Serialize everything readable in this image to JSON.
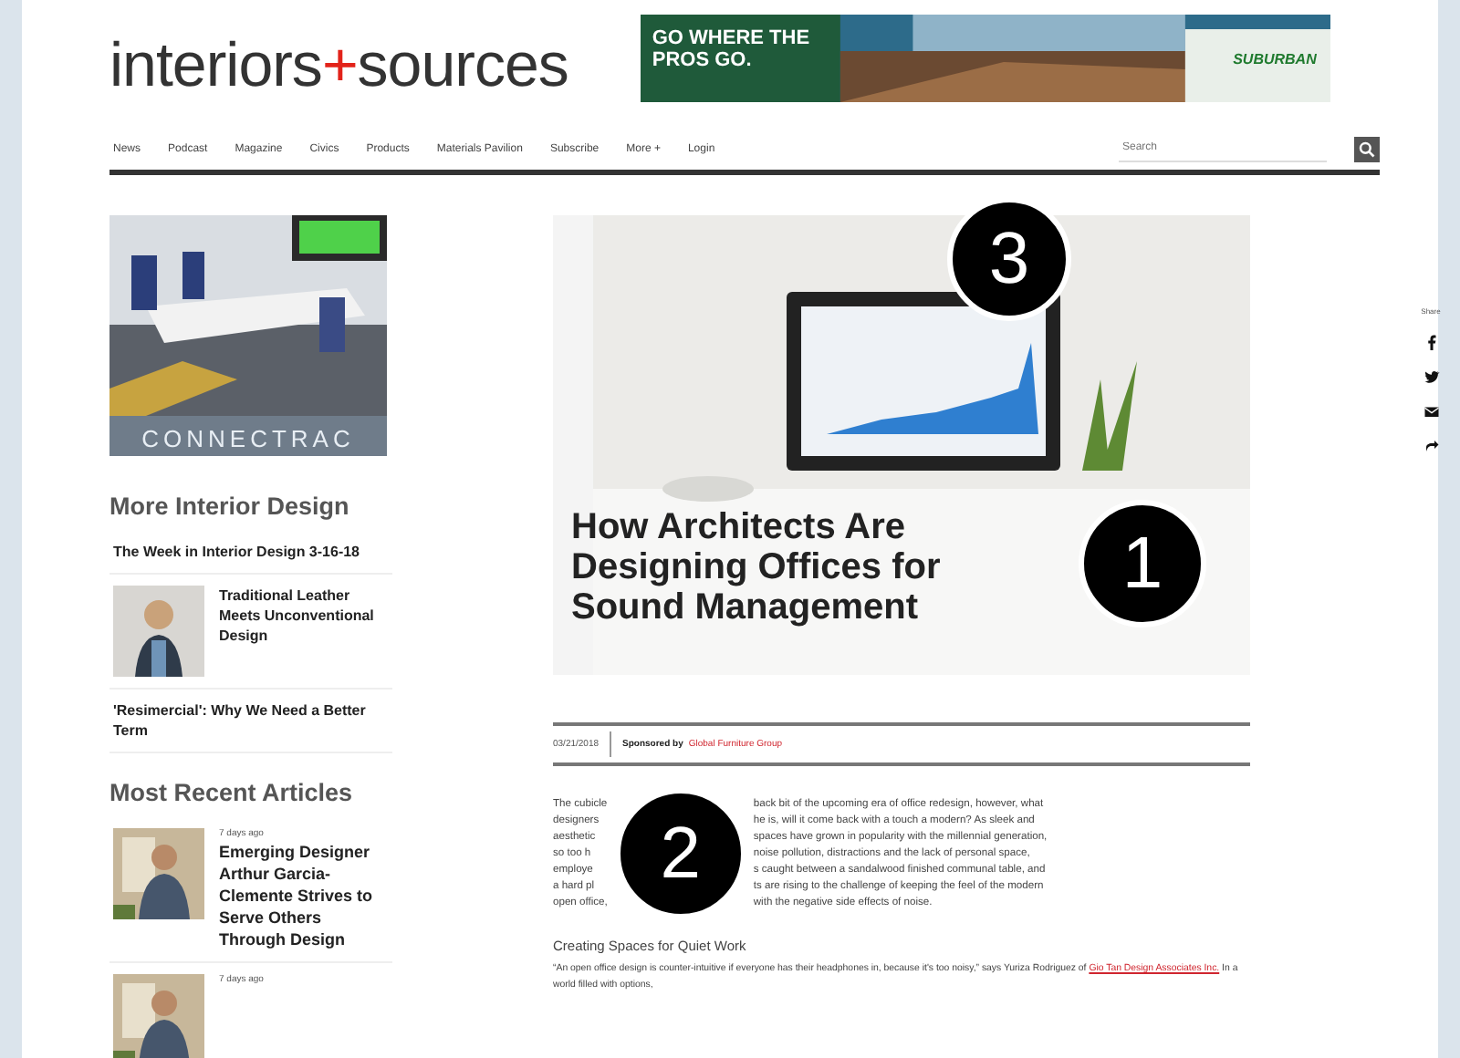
{
  "logo": {
    "text": "interiors",
    "plus": "+",
    "rest": "sources"
  },
  "ad_banner": {
    "headline": "GO WHERE THE PROS GO.",
    "brand": "SUBURBAN"
  },
  "nav": {
    "items": [
      "News",
      "Podcast",
      "Magazine",
      "Civics",
      "Products",
      "Materials Pavilion",
      "Subscribe",
      "More +",
      "Login"
    ],
    "search": {
      "placeholder": "Search"
    }
  },
  "sidebar": {
    "ad": {
      "caption": "CONNECTRAC"
    },
    "more_heading": "More Interior Design",
    "more_items": [
      {
        "title": "The Week in Interior Design 3-16-18",
        "thumbnail": false
      },
      {
        "title": "Traditional Leather Meets Unconventional Design",
        "thumbnail": true
      },
      {
        "title": "'Resimercial': Why We Need a Better Term",
        "thumbnail": false
      }
    ],
    "recent_heading": "Most Recent Articles",
    "recent_items": [
      {
        "time": "7 days ago",
        "title": "Emerging Designer Arthur Garcia-Clemente Strives to Serve Others Through Design"
      },
      {
        "time": "7 days ago"
      }
    ]
  },
  "article": {
    "title": "How Architects Are Designing Offices for Sound Management",
    "date": "03/21/2018",
    "sponsor_label": "Sponsored by",
    "sponsor": "Global Furniture Group",
    "intro_lines": [
      {
        "left": "The cubicle",
        "right": "back bit of the upcoming era of office redesign, however, what"
      },
      {
        "left": "designers",
        "right": "he is, will it come back with a touch a modern? As sleek and"
      },
      {
        "left": "aesthetic",
        "right": "spaces have grown in popularity with the millennial generation,"
      },
      {
        "left": "so too h",
        "right": "noise pollution, distractions and the lack of personal space,"
      },
      {
        "left": "employe",
        "right": "s caught between a sandalwood finished communal table, and"
      },
      {
        "left": "a hard pl",
        "right": "ts are rising to the challenge of keeping the feel of the modern"
      },
      {
        "left": "open office,",
        "right": "with the negative side effects of noise."
      }
    ],
    "subheading": "Creating Spaces for Quiet Work",
    "quote": {
      "before": "“An open office design is counter-intuitive if everyone has their headphones in, because it's too noisy,” says Yuriza Rodriguez of ",
      "link": "Gio Tan Design Associates Inc.",
      "after": " In a world filled with options,"
    }
  },
  "share": {
    "label": "Share",
    "icons": [
      {
        "kind": "facebook"
      },
      {
        "kind": "twitter"
      },
      {
        "kind": "email"
      },
      {
        "kind": "more"
      }
    ]
  },
  "markers": [
    {
      "number": "3"
    },
    {
      "number": "1"
    },
    {
      "number": "2"
    }
  ]
}
